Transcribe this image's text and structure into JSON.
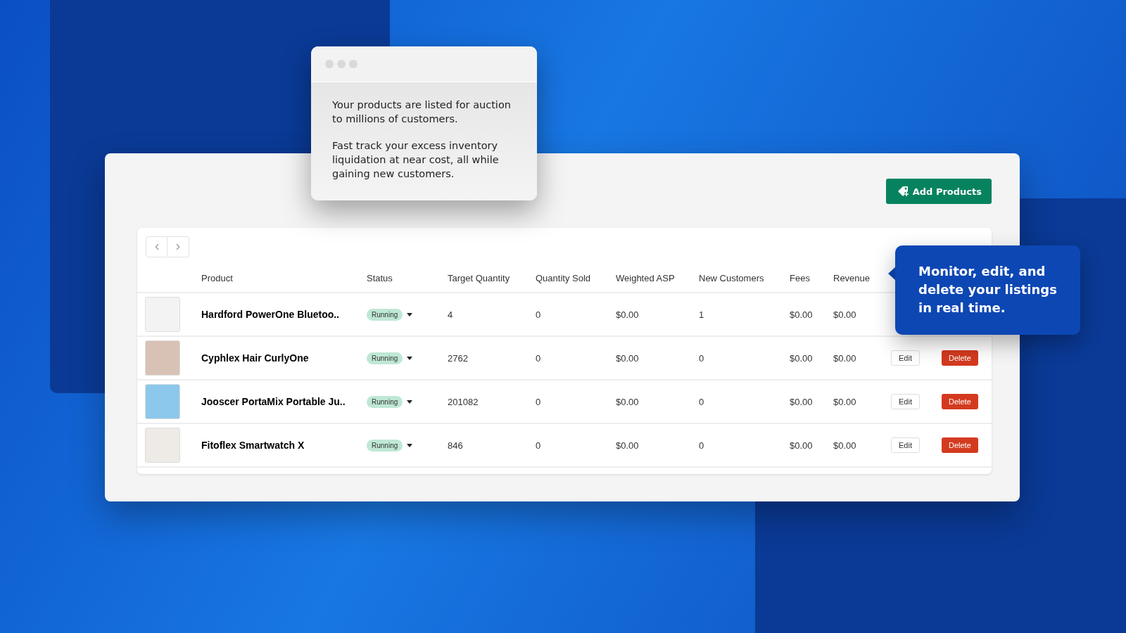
{
  "info_window": {
    "paragraphs": [
      "Your products are listed for auction to millions of customers.",
      "Fast track your excess inventory liquidation at near cost, all while gaining new customers."
    ]
  },
  "add_button": {
    "label": "Add Products"
  },
  "table": {
    "columns": [
      "Product",
      "Status",
      "Target Quantity",
      "Quantity Sold",
      "Weighted ASP",
      "New Customers",
      "Fees",
      "Revenue"
    ],
    "rows": [
      {
        "product": "Hardford PowerOne Bluetoo..",
        "status": "Running",
        "target_quantity": "4",
        "quantity_sold": "0",
        "weighted_asp": "$0.00",
        "new_customers": "1",
        "fees": "$0.00",
        "revenue": "$0.00"
      },
      {
        "product": "Cyphlex Hair CurlyOne",
        "status": "Running",
        "target_quantity": "2762",
        "quantity_sold": "0",
        "weighted_asp": "$0.00",
        "new_customers": "0",
        "fees": "$0.00",
        "revenue": "$0.00",
        "actions": [
          "Edit",
          "Delete"
        ]
      },
      {
        "product": "Jooscer PortaMix Portable Ju..",
        "status": "Running",
        "target_quantity": "201082",
        "quantity_sold": "0",
        "weighted_asp": "$0.00",
        "new_customers": "0",
        "fees": "$0.00",
        "revenue": "$0.00",
        "actions": [
          "Edit",
          "Delete"
        ]
      },
      {
        "product": "Fitoflex Smartwatch X",
        "status": "Running",
        "target_quantity": "846",
        "quantity_sold": "0",
        "weighted_asp": "$0.00",
        "new_customers": "0",
        "fees": "$0.00",
        "revenue": "$0.00",
        "actions": [
          "Edit",
          "Delete"
        ]
      }
    ]
  },
  "callout": {
    "text": "Monitor, edit, and delete your listings in real time."
  }
}
